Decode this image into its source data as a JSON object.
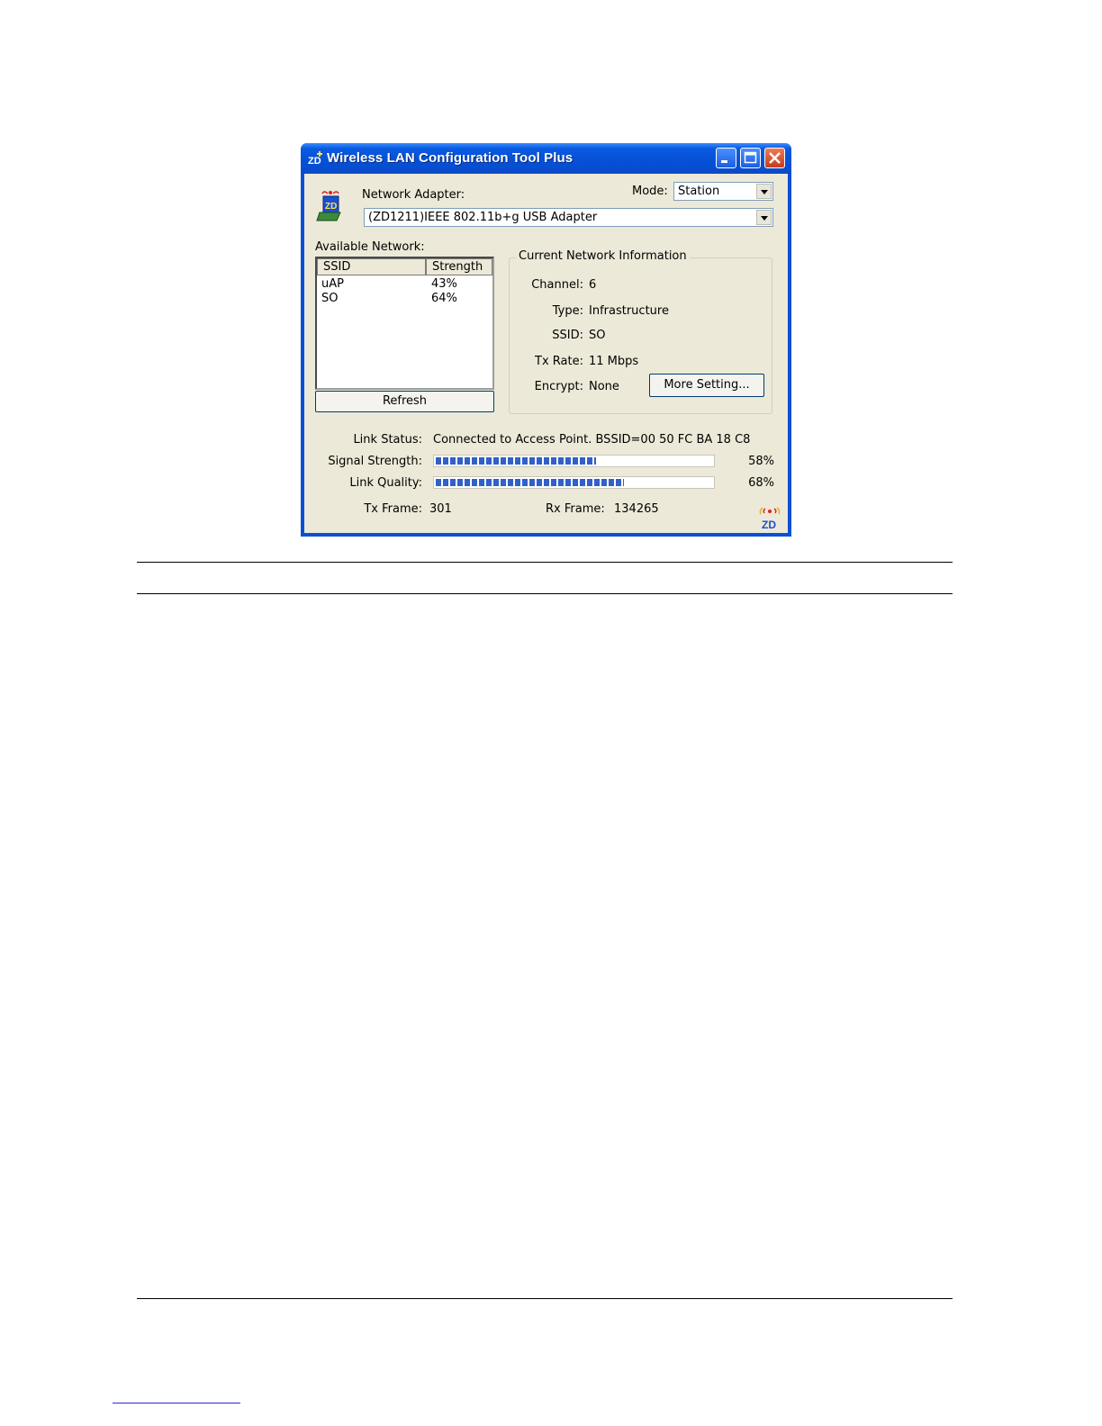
{
  "window": {
    "title": "Wireless LAN Configuration Tool Plus"
  },
  "adapter": {
    "label": "Network Adapter:",
    "value": "(ZD1211)IEEE 802.11b+g USB Adapter"
  },
  "mode": {
    "label": "Mode:",
    "value": "Station"
  },
  "available": {
    "label": "Available Network:",
    "columns": [
      "SSID",
      "Strength"
    ],
    "rows": [
      {
        "ssid": "uAP",
        "strength": "43%"
      },
      {
        "ssid": "SO",
        "strength": "64%"
      }
    ],
    "refresh_label": "Refresh"
  },
  "current": {
    "title": "Current Network Information",
    "channel_label": "Channel:",
    "channel_value": "6",
    "type_label": "Type:",
    "type_value": "Infrastructure",
    "ssid_label": "SSID:",
    "ssid_value": "SO",
    "txrate_label": "Tx Rate:",
    "txrate_value": "11 Mbps",
    "encrypt_label": "Encrypt:",
    "encrypt_value": "None",
    "more_label": "More Setting..."
  },
  "status": {
    "link_status_label": "Link Status:",
    "link_status_value": "Connected to Access Point. BSSID=00 50 FC BA 18 C8",
    "signal_label": "Signal Strength:",
    "signal_text": "58%",
    "signal_level": 0.58,
    "quality_label": "Link Quality:",
    "quality_text": "68%",
    "quality_level": 0.68,
    "tx_label": "Tx Frame:",
    "tx_value": "301",
    "rx_label": "Rx Frame:",
    "rx_value": "134265"
  },
  "icons": [
    "zd-app-icon",
    "minimize-icon",
    "maximize-icon",
    "close-icon",
    "adapter-icon",
    "zd-logo-icon"
  ],
  "colors": {
    "titlebar": "#0550d8",
    "client_bg": "#ece9d8",
    "progress": "#3160c8",
    "close_button": "#c9391a"
  }
}
